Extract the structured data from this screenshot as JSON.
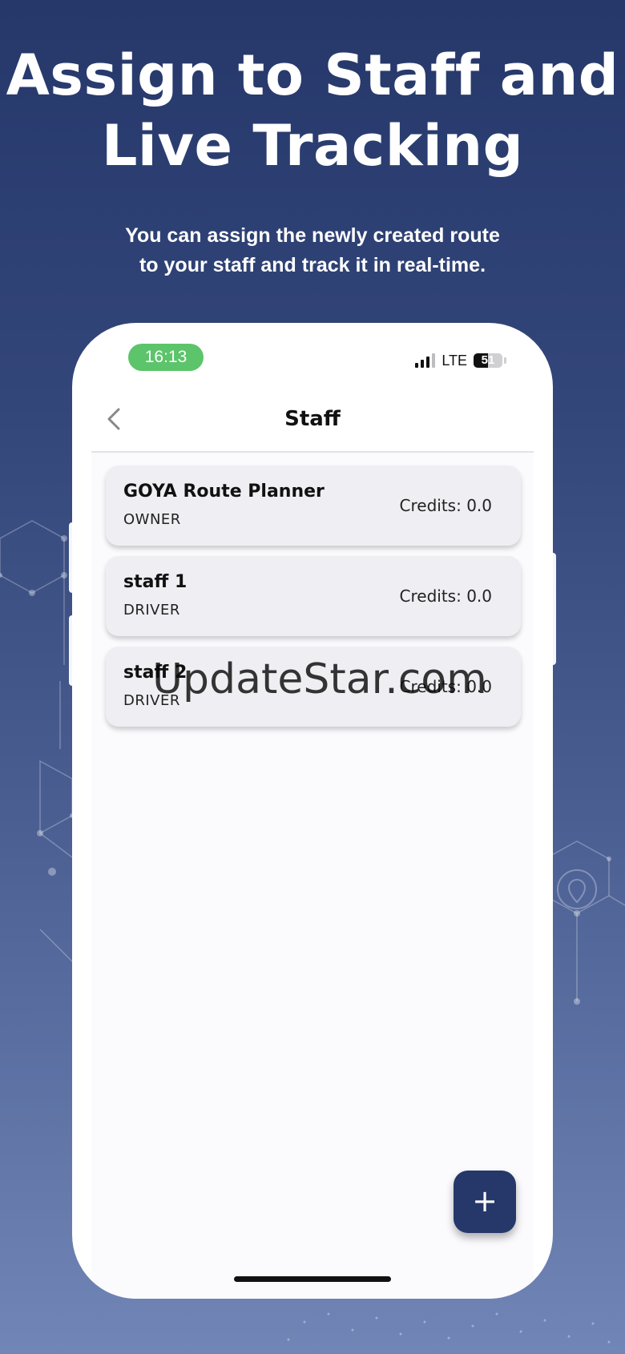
{
  "promo": {
    "title_line1": "Assign to Staff and",
    "title_line2": "Live Tracking",
    "subtitle_line1": "You can assign the newly created route",
    "subtitle_line2": "to your staff and track it in real-time."
  },
  "status_bar": {
    "time": "16:13",
    "network": "LTE",
    "battery": "51",
    "battery_level": 0.51
  },
  "nav": {
    "title": "Staff",
    "back_icon": "chevron-left-icon"
  },
  "staff": [
    {
      "name": "GOYA Route Planner",
      "role": "OWNER",
      "credits": "Credits: 0.0"
    },
    {
      "name": "staff 1",
      "role": "DRIVER",
      "credits": "Credits: 0.0"
    },
    {
      "name": "staff 2",
      "role": "DRIVER",
      "credits": "Credits: 0.0"
    }
  ],
  "fab": {
    "label": "+",
    "icon": "plus-icon"
  },
  "watermark": "UpdateStar.com",
  "colors": {
    "background_top": "#26386a",
    "background_bottom": "#7186b6",
    "time_pill": "#5cc46a",
    "fab": "#26386a",
    "card": "#efeff3"
  }
}
